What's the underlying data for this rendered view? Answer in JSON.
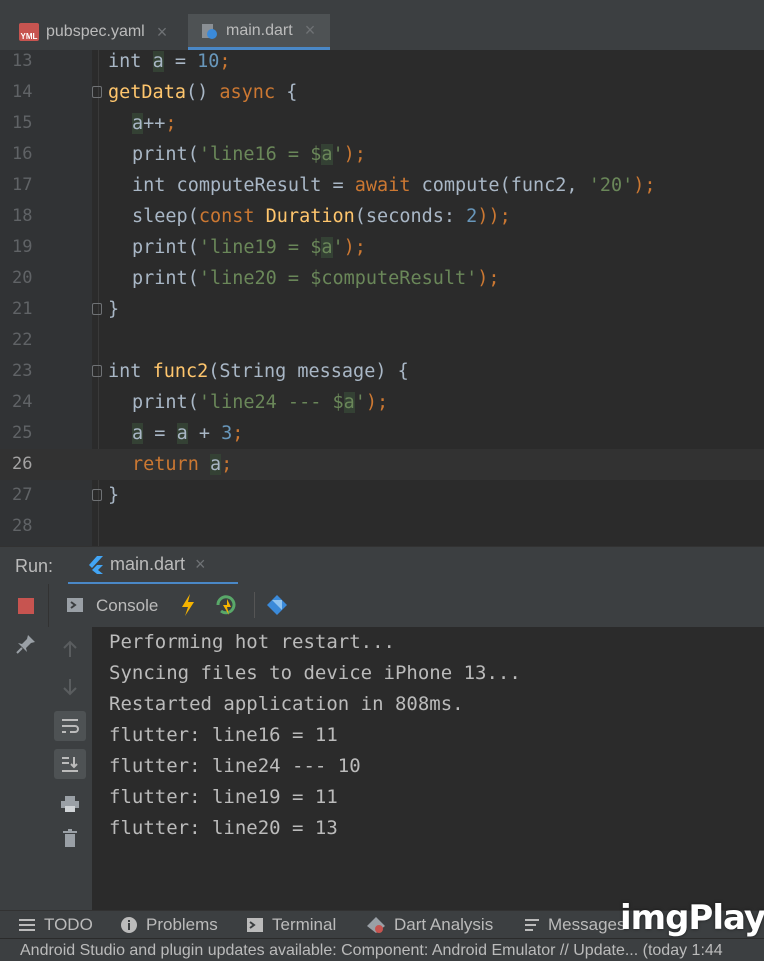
{
  "tabs": [
    {
      "label": "pubspec.yaml",
      "icon": "yaml-file-icon",
      "active": false
    },
    {
      "label": "main.dart",
      "icon": "dart-file-icon",
      "active": true
    }
  ],
  "tab_close_glyph": "×",
  "editor": {
    "lines": [
      {
        "num": "13"
      },
      {
        "num": "14"
      },
      {
        "num": "15"
      },
      {
        "num": "16"
      },
      {
        "num": "17"
      },
      {
        "num": "18"
      },
      {
        "num": "19"
      },
      {
        "num": "20"
      },
      {
        "num": "21"
      },
      {
        "num": "22"
      },
      {
        "num": "23"
      },
      {
        "num": "24"
      },
      {
        "num": "25"
      },
      {
        "num": "26"
      },
      {
        "num": "27"
      },
      {
        "num": "28"
      }
    ],
    "current_line": "26",
    "tokens": {
      "l13": [
        "int ",
        "a",
        " = ",
        "10",
        ";"
      ],
      "l14": [
        "getData",
        "() ",
        "async",
        " {"
      ],
      "l15": [
        "a",
        "++",
        ";"
      ],
      "l16": [
        "print(",
        "'line16 = $",
        "a",
        "'",
        ");"
      ],
      "l17": [
        "int computeResult = ",
        "await",
        " compute(func2, ",
        "'20'",
        ");"
      ],
      "l18": [
        "sleep(",
        "const",
        " ",
        "Duration",
        "(seconds: ",
        "2",
        "));"
      ],
      "l19": [
        "print(",
        "'line19 = $",
        "a",
        "'",
        ");"
      ],
      "l20": [
        "print(",
        "'line20 = $computeResult'",
        ");"
      ],
      "l21": [
        "}"
      ],
      "l23": [
        "int ",
        "func2",
        "(String message) {"
      ],
      "l24": [
        "print(",
        "'line24 --- $",
        "a",
        "'",
        ");"
      ],
      "l25": [
        "a",
        " = ",
        "a",
        " + ",
        "3",
        ";"
      ],
      "l26": [
        "return",
        " ",
        "a",
        ";"
      ],
      "l27": [
        "}"
      ]
    }
  },
  "run": {
    "label": "Run:",
    "tab_label": "main.dart"
  },
  "console": {
    "tab_label": "Console",
    "lines": [
      "Performing hot restart...",
      "Syncing files to device iPhone 13...",
      "Restarted application in 808ms.",
      "flutter: line16 = 11",
      "flutter: line24 --- 10",
      "flutter: line19 = 11",
      "flutter: line20 = 13"
    ]
  },
  "bottom": {
    "items": [
      {
        "label": "TODO",
        "icon": "list-icon"
      },
      {
        "label": "Problems",
        "icon": "info-icon"
      },
      {
        "label": "Terminal",
        "icon": "terminal-icon"
      },
      {
        "label": "Dart Analysis",
        "icon": "dart-analysis-icon"
      },
      {
        "label": "Messages",
        "icon": "messages-icon"
      }
    ]
  },
  "status": "Android Studio and plugin updates available: Component: Android Emulator // Update... (today 1:44",
  "watermark": "imgPlay",
  "colors": {
    "keyword": "#cc7832",
    "number": "#6897bb",
    "string": "#6a8759",
    "function": "#ffc66d",
    "accent": "#4a88c7",
    "stop": "#c75450"
  }
}
